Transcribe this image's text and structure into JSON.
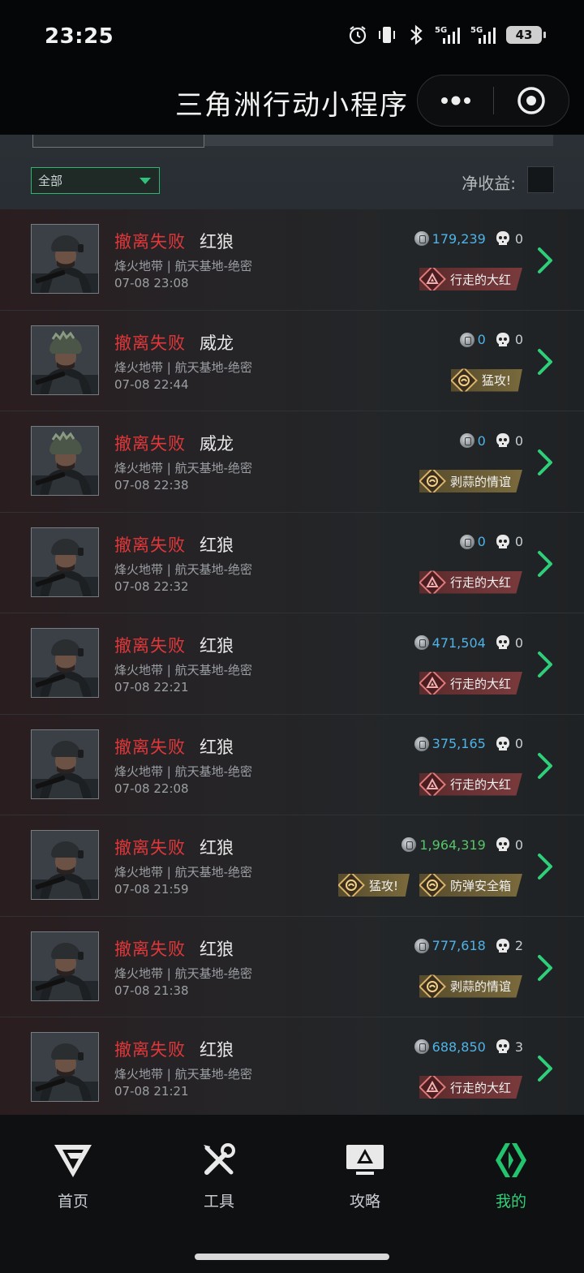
{
  "status_bar": {
    "time": "23:25",
    "battery": "43",
    "signal1": "5G",
    "signal2": "5G"
  },
  "nav": {
    "title": "三角洲行动小程序"
  },
  "filter": {
    "selected": "全部",
    "net_income_label": "净收益:"
  },
  "records": [
    {
      "status": "撤离失败",
      "operator": "红狼",
      "map": "烽火地带 | 航天基地-绝密",
      "time": "07-08 23:08",
      "value": "179,239",
      "value_color": "blue",
      "kills": "0",
      "avatar": "redwolf",
      "badges": [
        {
          "text": "行走的大红",
          "type": "red"
        }
      ]
    },
    {
      "status": "撤离失败",
      "operator": "威龙",
      "map": "烽火地带 | 航天基地-绝密",
      "time": "07-08 22:44",
      "value": "0",
      "value_color": "blue",
      "kills": "0",
      "avatar": "weilong",
      "badges": [
        {
          "text": "猛攻!",
          "type": "gold"
        }
      ]
    },
    {
      "status": "撤离失败",
      "operator": "威龙",
      "map": "烽火地带 | 航天基地-绝密",
      "time": "07-08 22:38",
      "value": "0",
      "value_color": "blue",
      "kills": "0",
      "avatar": "weilong",
      "badges": [
        {
          "text": "剥蒜的情谊",
          "type": "gold"
        }
      ]
    },
    {
      "status": "撤离失败",
      "operator": "红狼",
      "map": "烽火地带 | 航天基地-绝密",
      "time": "07-08 22:32",
      "value": "0",
      "value_color": "blue",
      "kills": "0",
      "avatar": "redwolf",
      "badges": [
        {
          "text": "行走的大红",
          "type": "red"
        }
      ]
    },
    {
      "status": "撤离失败",
      "operator": "红狼",
      "map": "烽火地带 | 航天基地-绝密",
      "time": "07-08 22:21",
      "value": "471,504",
      "value_color": "blue",
      "kills": "0",
      "avatar": "redwolf",
      "badges": [
        {
          "text": "行走的大红",
          "type": "red"
        }
      ]
    },
    {
      "status": "撤离失败",
      "operator": "红狼",
      "map": "烽火地带 | 航天基地-绝密",
      "time": "07-08 22:08",
      "value": "375,165",
      "value_color": "blue",
      "kills": "0",
      "avatar": "redwolf",
      "badges": [
        {
          "text": "行走的大红",
          "type": "red"
        }
      ]
    },
    {
      "status": "撤离失败",
      "operator": "红狼",
      "map": "烽火地带 | 航天基地-绝密",
      "time": "07-08 21:59",
      "value": "1,964,319",
      "value_color": "green",
      "kills": "0",
      "avatar": "redwolf",
      "badges": [
        {
          "text": "猛攻!",
          "type": "gold"
        },
        {
          "text": "防弹安全箱",
          "type": "gold"
        }
      ]
    },
    {
      "status": "撤离失败",
      "operator": "红狼",
      "map": "烽火地带 | 航天基地-绝密",
      "time": "07-08 21:38",
      "value": "777,618",
      "value_color": "blue",
      "kills": "2",
      "avatar": "redwolf",
      "badges": [
        {
          "text": "剥蒜的情谊",
          "type": "gold"
        }
      ]
    },
    {
      "status": "撤离失败",
      "operator": "红狼",
      "map": "烽火地带 | 航天基地-绝密",
      "time": "07-08 21:21",
      "value": "688,850",
      "value_color": "blue",
      "kills": "3",
      "avatar": "redwolf",
      "badges": [
        {
          "text": "行走的大红",
          "type": "red"
        }
      ]
    }
  ],
  "bottom_nav": [
    {
      "label": "首页",
      "icon": "home-logo-icon",
      "active": false
    },
    {
      "label": "工具",
      "icon": "tools-icon",
      "active": false
    },
    {
      "label": "攻略",
      "icon": "guide-monitor-icon",
      "active": false
    },
    {
      "label": "我的",
      "icon": "profile-logo-icon",
      "active": true
    }
  ],
  "colors": {
    "accent": "#33d17a",
    "fail_red": "#e0383a",
    "value_blue": "#4fb3e8",
    "value_green": "#58c46a"
  }
}
